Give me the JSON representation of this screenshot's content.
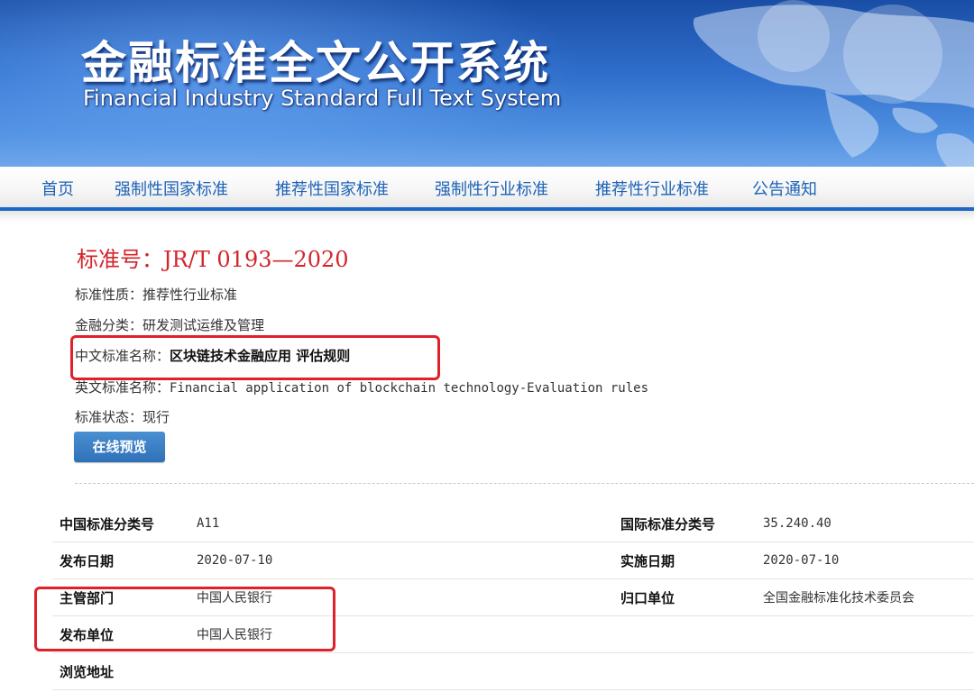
{
  "header": {
    "title_cn": "金融标准全文公开系统",
    "title_en": "Financial Industry Standard Full Text System"
  },
  "nav": {
    "items": [
      "首页",
      "强制性国家标准",
      "推荐性国家标准",
      "强制性行业标准",
      "推荐性行业标准",
      "公告通知"
    ]
  },
  "standard": {
    "number_label": "标准号：",
    "number_value": "JR/T 0193—2020",
    "nature_label": "标准性质：",
    "nature_value": "推荐性行业标准",
    "category_label": "金融分类：",
    "category_value": "研发测试运维及管理",
    "cn_name_label": "中文标准名称：",
    "cn_name_value": "区块链技术金融应用 评估规则",
    "en_name_label": "英文标准名称：",
    "en_name_value": "Financial application of blockchain technology-Evaluation rules",
    "status_label": "标准状态：",
    "status_value": "现行",
    "preview_button": "在线预览"
  },
  "info_table": {
    "rows": [
      {
        "k1": "中国标准分类号",
        "v1": "A11",
        "k2": "国际标准分类号",
        "v2": "35.240.40"
      },
      {
        "k1": "发布日期",
        "v1": "2020-07-10",
        "k2": "实施日期",
        "v2": "2020-07-10"
      },
      {
        "k1": "主管部门",
        "v1": "中国人民银行",
        "k2": "归口单位",
        "v2": "全国金融标准化技术委员会"
      },
      {
        "k1": "发布单位",
        "v1": "中国人民银行",
        "k2": "",
        "v2": ""
      },
      {
        "k1": "浏览地址",
        "v1": "",
        "k2": "",
        "v2": ""
      }
    ]
  },
  "colors": {
    "banner": "#2f6fcc",
    "nav_text": "#1e63b6",
    "nav_line": "#1c68c4",
    "std_number": "#d2262c",
    "button": "#2f71b8",
    "annotation": "#e0202a"
  }
}
